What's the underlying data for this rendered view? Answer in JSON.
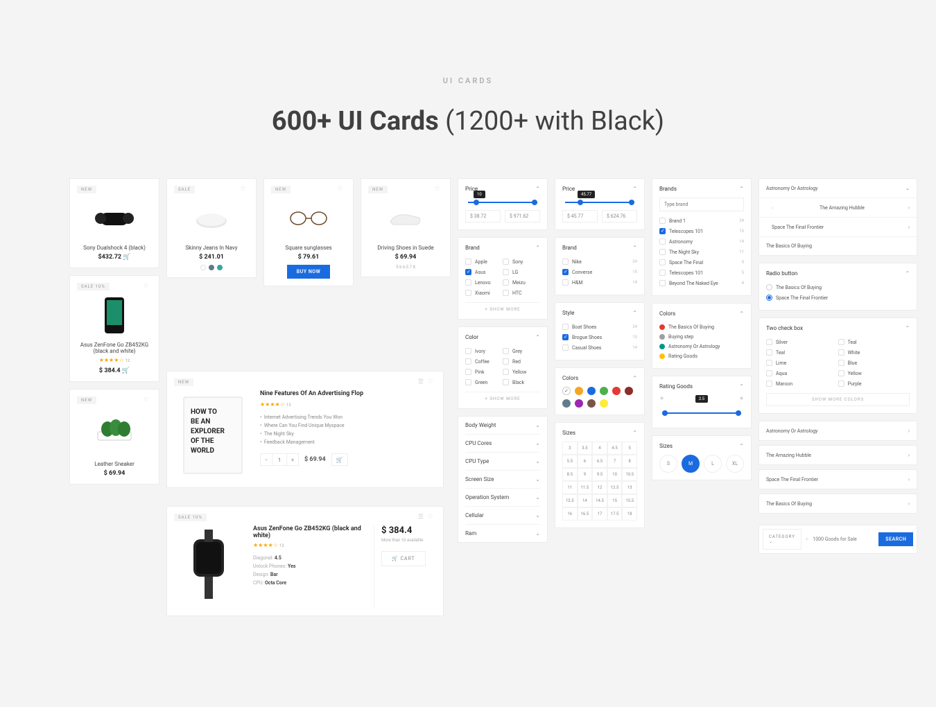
{
  "header": {
    "eyebrow": "UI CARDS",
    "title_bold": "600+ UI Cards",
    "title_rest": " (1200+ with Black)"
  },
  "badges": {
    "new": "NEW",
    "sale": "SALE",
    "sale10": "SALE 10%"
  },
  "products": {
    "p1": {
      "name": "Sony Dualshock 4 (black)",
      "price": "$432.72"
    },
    "p2": {
      "name": "Skinny Jeans In Navy",
      "price": "$ 241.01"
    },
    "p3": {
      "name": "Square sunglasses",
      "price": "$ 79.61",
      "buy": "BUY NOW"
    },
    "p4": {
      "name": "Driving Shoes in Suede",
      "price": "$ 69.94",
      "sizes": "5 6 6.5 7 8"
    },
    "p5": {
      "name": "Asus ZenFone Go ZB452KG (black and white)",
      "price": "$ 384.4",
      "reviews": "12"
    },
    "p6": {
      "title": "Nine Features Of An Advertising Flop",
      "reviews": "13",
      "bullets": [
        "Internet Advertising Trends You Won",
        "Where Can You Find Unique Myspace",
        "The Night Sky",
        "Feedback Management"
      ],
      "qty": "1",
      "price": "$ 69.94"
    },
    "p7": {
      "name": "Leather Sneaker",
      "price": "$ 69.94"
    },
    "p8": {
      "title": "Asus ZenFone Go ZB452KG (black and white)",
      "reviews": "13",
      "specs": [
        [
          "Diagonal:",
          "4.5"
        ],
        [
          "Unlock Phones:",
          "Yes"
        ],
        [
          "Design:",
          "Bar"
        ],
        [
          "CPU:",
          "Octa Core"
        ]
      ],
      "price": "$ 384.4",
      "avail": "More than 10 available",
      "cart": "CART"
    }
  },
  "filters": {
    "price1": {
      "label": "Price",
      "val": "10",
      "min": "$ 38.72",
      "max": "$ 971.62"
    },
    "brand1": {
      "label": "Brand",
      "items": [
        [
          "Apple",
          false
        ],
        [
          "Sony",
          false
        ],
        [
          "Asus",
          true
        ],
        [
          "LG",
          false
        ],
        [
          "Lenovo",
          false
        ],
        [
          "Meizu",
          false
        ],
        [
          "Xiaomi",
          false
        ],
        [
          "HTC",
          false
        ]
      ],
      "more": "+  SHOW MORE"
    },
    "color1": {
      "label": "Color",
      "items": [
        [
          "Ivory",
          "Grey"
        ],
        [
          "Coffee",
          "Red"
        ],
        [
          "Pink",
          "Yellow"
        ],
        [
          "Green",
          "Black"
        ]
      ],
      "more": "+  SHOW MORE"
    },
    "collapsed": [
      "Body Weight",
      "CPU Cores",
      "CPU Type",
      "Screen Size",
      "Operation System",
      "Cellular",
      "Ram"
    ],
    "price2": {
      "label": "Price",
      "val": "45.77",
      "min": "$ 45.77",
      "max": "$ 624.76"
    },
    "brand2": {
      "label": "Brand",
      "items": [
        [
          "Nike",
          false,
          "24"
        ],
        [
          "Converse",
          true,
          "15"
        ],
        [
          "H&M",
          false,
          "14"
        ]
      ]
    },
    "style2": {
      "label": "Style",
      "items": [
        [
          "Boat Shoes",
          false,
          "24"
        ],
        [
          "Brogue Shoes",
          true,
          "15"
        ],
        [
          "Casual Shoes",
          false,
          "14"
        ]
      ]
    },
    "colors2": {
      "label": "Colors",
      "hex": [
        "#fff",
        "#f5a623",
        "#1b6be0",
        "#4caf50",
        "#e53935",
        "#8e2b2b",
        "#607d8b",
        "#9c27b0",
        "#795548",
        "#ffeb3b"
      ]
    },
    "sizes2": {
      "label": "Sizes",
      "vals": [
        "3",
        "3.5",
        "4",
        "4.5",
        "5",
        "5.5",
        "6",
        "6.5",
        "7",
        "8",
        "8.5",
        "9",
        "9.5",
        "10",
        "10.5",
        "11",
        "11.5",
        "12",
        "12.5",
        "13",
        "13.5",
        "14",
        "14.5",
        "15",
        "15.5",
        "16",
        "16.5",
        "17",
        "17.5",
        "18"
      ]
    },
    "brands3": {
      "label": "Brands",
      "ph": "Type brand",
      "items": [
        [
          "Brand 1",
          false,
          "24"
        ],
        [
          "Telescopes 101",
          true,
          "15"
        ],
        [
          "Astronomy",
          false,
          "14"
        ],
        [
          "The Night Sky",
          false,
          "11"
        ],
        [
          "Space The Final",
          false,
          "9"
        ],
        [
          "Telescopes 101",
          false,
          "5"
        ],
        [
          "Beyond The Naked Eye",
          false,
          "4"
        ]
      ]
    },
    "colors3": {
      "label": "Colors",
      "items": [
        [
          "#e53935",
          "The Basics Of Buying"
        ],
        [
          "#9e9e9e",
          "Buying step"
        ],
        [
          "#009688",
          "Astronomy Or Astrology"
        ],
        [
          "#ffc107",
          "Rating Goods"
        ]
      ]
    },
    "rating3": {
      "label": "Rating Goods",
      "val": "2.5"
    },
    "sizes3": {
      "label": "Sizes",
      "opts": [
        "S",
        "M",
        "L",
        "XL"
      ],
      "on": "M"
    },
    "astro": {
      "label": "Astronomy Or Astrology",
      "items": [
        "The Amazing Hubble",
        "Space The Final Frontier"
      ],
      "footer": "The Basics Of Buying"
    },
    "radio": {
      "label": "Radio button",
      "items": [
        [
          "The Basics Of Buying",
          false
        ],
        [
          "Space The Final Frontier",
          true
        ]
      ]
    },
    "twochk": {
      "label": "Two check box",
      "items": [
        [
          "Silver",
          "Teal"
        ],
        [
          "Teal",
          "White"
        ],
        [
          "Lime",
          "Blue"
        ],
        [
          "Aqua",
          "Yellow"
        ],
        [
          "Maroon",
          "Purple"
        ]
      ],
      "more": "SHOW MORE COLORS"
    },
    "links": [
      "Astronomy Or Astrology",
      "The Amazing Hubble",
      "Space The Final Frontier",
      "The Basics Of Buying"
    ],
    "search": {
      "cat": "CATEGORY",
      "ph": "1000 Goods for Sale",
      "btn": "SEARCH"
    }
  }
}
